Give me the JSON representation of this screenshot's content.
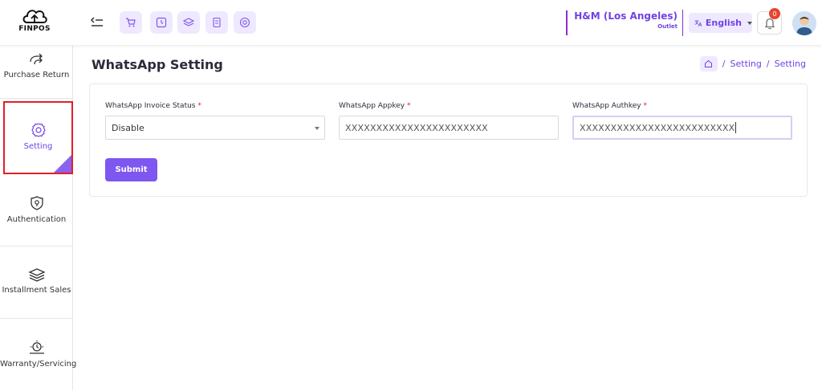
{
  "brand": {
    "logo_text": "FINPOS"
  },
  "header": {
    "quick_icons": [
      "cart-icon",
      "clock-icon",
      "layers-icon",
      "receipt-icon",
      "target-icon"
    ],
    "outlet_name": "H&M (Los Angeles)",
    "outlet_type": "Outlet",
    "language": "English",
    "notification_count": "0",
    "accent": "#6f42e6"
  },
  "sidebar": {
    "items": [
      {
        "label": "Purchase Return",
        "icon": "return-arrow-icon"
      },
      {
        "label": "Setting",
        "icon": "gear-icon",
        "active": true
      },
      {
        "label": "Authentication",
        "icon": "shield-icon"
      },
      {
        "label": "Installment Sales",
        "icon": "layers-icon"
      },
      {
        "label": "Warranty/Servicing",
        "icon": "warranty-icon"
      }
    ]
  },
  "main": {
    "title": "WhatsApp Setting",
    "breadcrumb": [
      "Setting",
      "Setting"
    ]
  },
  "form": {
    "status": {
      "label": "WhatsApp Invoice Status",
      "required": "*",
      "value": "Disable"
    },
    "appkey": {
      "label": "WhatsApp Appkey",
      "required": "*",
      "value": "XXXXXXXXXXXXXXXXXXXXXXX"
    },
    "authkey": {
      "label": "WhatsApp Authkey",
      "required": "*",
      "value": "XXXXXXXXXXXXXXXXXXXXXXXXX"
    },
    "submit_label": "Submit"
  }
}
